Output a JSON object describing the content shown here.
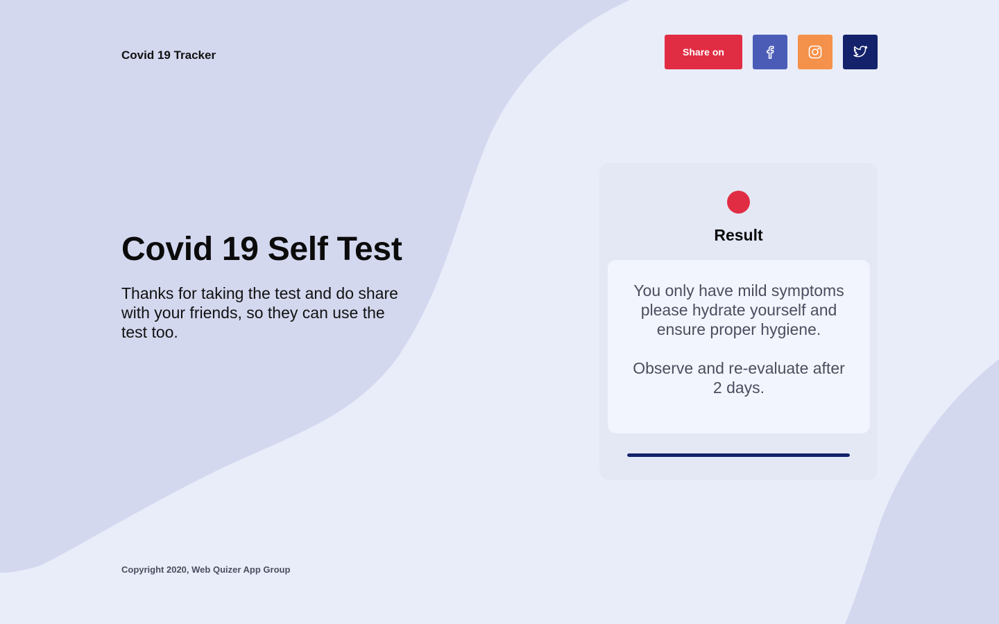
{
  "header": {
    "brand": "Covid 19 Tracker",
    "share_label": "Share on",
    "social": [
      {
        "name": "facebook",
        "icon": "facebook-icon",
        "color": "#4b5cb7"
      },
      {
        "name": "instagram",
        "icon": "instagram-icon",
        "color": "#f4914a"
      },
      {
        "name": "twitter",
        "icon": "twitter-icon",
        "color": "#13226a"
      }
    ]
  },
  "hero": {
    "title": "Covid 19 Self Test",
    "subtitle": "Thanks for taking the test and do share with your friends, so they can use the test too."
  },
  "result": {
    "heading": "Result",
    "status_color": "#e12d44",
    "message_1": "You only have mild symptoms please hydrate yourself and ensure proper hygiene.",
    "message_2": "Observe and re-evaluate after 2 days.",
    "progress": 1.0
  },
  "footer": {
    "copyright": "Copyright 2020, Web Quizer App Group"
  },
  "colors": {
    "background": "#e9edfa",
    "blob": "#d4d8ef",
    "accent": "#e12d44",
    "navy": "#13226a"
  }
}
